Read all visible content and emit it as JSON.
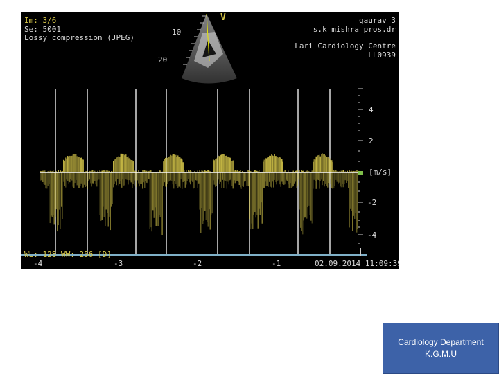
{
  "overlay": {
    "image_number": "Im: 3/6",
    "series": "Se: 5001",
    "compression": "Lossy compression (JPEG)",
    "patient_name": "gaurav 3",
    "patient_line2": "s.k mishra pros.dr",
    "institution": "Lari Cardiology Centre",
    "study_id": "LL0939",
    "depth_10": "10",
    "depth_20": "20",
    "window_level": "WL: 128 WW: 256 [D]",
    "datetime": "02.09.2014 11:09:39",
    "probe_marker": "V"
  },
  "velocity_axis": {
    "unit": "[m/s]",
    "ticks": [
      "4",
      "2",
      "-2",
      "-4"
    ]
  },
  "time_axis": {
    "ticks": [
      "-4",
      "-3",
      "-2",
      "-1"
    ]
  },
  "caption": {
    "line1": "Cardiology Department",
    "line2": "K.G.M.U"
  },
  "colors": {
    "doppler": "#d8c84a",
    "baseline": "#ffffff",
    "caption_bg": "#3d62a8"
  }
}
